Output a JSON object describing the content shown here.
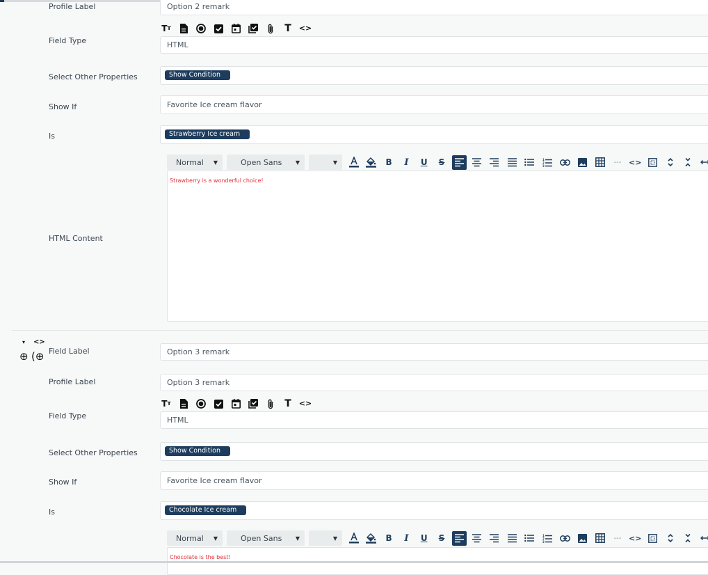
{
  "field_types": [
    {
      "name": "text-type-icon",
      "glyph": "Tт"
    },
    {
      "name": "document-type-icon"
    },
    {
      "name": "radio-type-icon"
    },
    {
      "name": "checkbox-type-icon"
    },
    {
      "name": "date-type-icon"
    },
    {
      "name": "multi-checkbox-type-icon"
    },
    {
      "name": "attachment-type-icon"
    },
    {
      "name": "title-type-icon",
      "glyph": "T"
    },
    {
      "name": "code-type-icon",
      "glyph": "<>"
    }
  ],
  "block1": {
    "profile_label": "Profile Label",
    "profile_value": "Option 2 remark",
    "field_type_label": "Field Type",
    "field_type_value": "HTML",
    "other_props_label": "Select Other Properties",
    "other_props_tag": "Show Condition",
    "show_if_label": "Show If",
    "show_if_value": "Favorite Ice cream flavor",
    "is_label": "Is",
    "is_tag": "Strawberry Ice cream",
    "html_content_label": "HTML Content",
    "editor_text": "Strawberry is a wonderful choice!"
  },
  "block2": {
    "field_label": "Field Label",
    "field_label_value": "Option 3 remark",
    "profile_label": "Profile Label",
    "profile_value": "Option 3 remark",
    "field_type_label": "Field Type",
    "field_type_value": "HTML",
    "other_props_label": "Select Other Properties",
    "other_props_tag": "Show Condition",
    "show_if_label": "Show If",
    "show_if_value": "Favorite Ice cream flavor",
    "is_label": "Is",
    "is_tag": "Chocolate Ice cream",
    "editor_text": "Chocolate is the best!"
  },
  "editor": {
    "paragraph_style": "Normal",
    "font_family": "Open Sans",
    "font_size": ""
  },
  "controls": {
    "collapse_glyph": "▾",
    "code_glyph": "<>",
    "add_glyph": "⊕",
    "insert_glyph": "(⊕"
  },
  "colors": {
    "accent": "#1e3d5e",
    "editor_text": "#e0303a"
  }
}
